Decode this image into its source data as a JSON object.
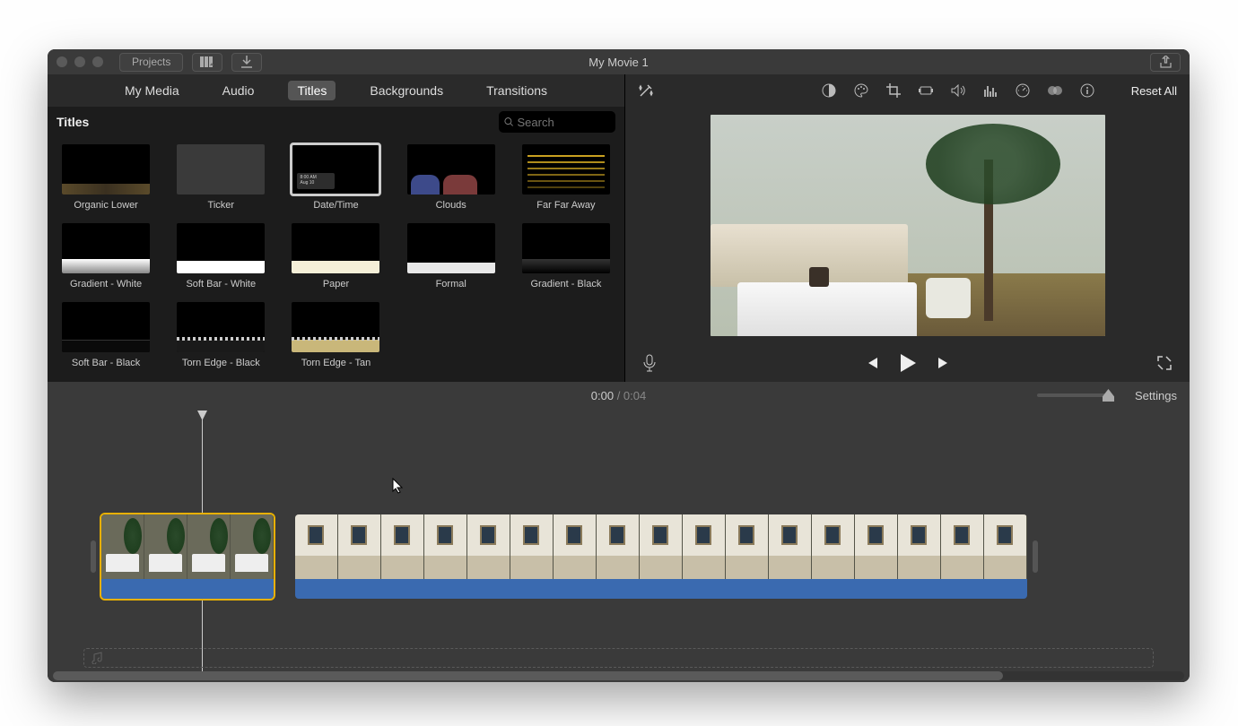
{
  "window": {
    "title": "My Movie 1"
  },
  "titlebar": {
    "projects": "Projects"
  },
  "tabs": {
    "items": [
      "My Media",
      "Audio",
      "Titles",
      "Backgrounds",
      "Transitions"
    ],
    "active": "Titles"
  },
  "browser": {
    "heading": "Titles",
    "search_placeholder": "Search",
    "titles": [
      {
        "label": "Organic Lower",
        "cls": "t-organic"
      },
      {
        "label": "Ticker",
        "cls": "gray"
      },
      {
        "label": "Date/Time",
        "cls": "t-date",
        "selected": true
      },
      {
        "label": "Clouds",
        "cls": "t-clouds"
      },
      {
        "label": "Far Far Away",
        "cls": "t-far"
      },
      {
        "label": "Gradient - White",
        "cls": "t-gw"
      },
      {
        "label": "Soft Bar - White",
        "cls": "t-sbw"
      },
      {
        "label": "Paper",
        "cls": "t-paper"
      },
      {
        "label": "Formal",
        "cls": "t-formal"
      },
      {
        "label": "Gradient - Black",
        "cls": "t-gb"
      },
      {
        "label": "Soft Bar - Black",
        "cls": "t-sbb"
      },
      {
        "label": "Torn Edge - Black",
        "cls": "t-teb"
      },
      {
        "label": "Torn Edge - Tan",
        "cls": "t-tet"
      }
    ]
  },
  "viewer": {
    "reset": "Reset All",
    "toolbar_icons": [
      "wand",
      "contrast",
      "palette",
      "crop",
      "camera",
      "audio",
      "equalizer",
      "speed",
      "color-shape",
      "info"
    ]
  },
  "timebar": {
    "current": "0:00",
    "duration": "0:04",
    "settings": "Settings"
  },
  "timeline": {
    "clip1_frames": 4,
    "clip2_frames": 17
  }
}
